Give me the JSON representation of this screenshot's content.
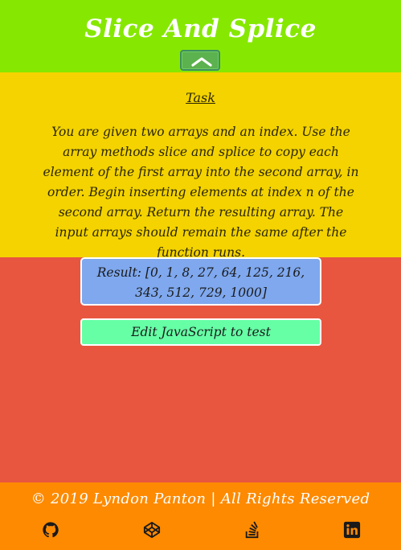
{
  "header": {
    "title": "Slice And Splice",
    "collapse_icon": "chevron-up-icon",
    "background": "#86e800"
  },
  "task": {
    "heading": "Task",
    "description": "You are given two arrays and an index. Use the array methods slice and splice to copy each element of the first array into the second array, in order. Begin inserting elements at index n of the second array. Return the resulting array. The input arrays should remain the same after the function runs.",
    "background": "#f4d300"
  },
  "result": {
    "label": "Result:",
    "value": "[0, 1, 8, 27, 64, 125, 216, 343, 512, 729, 1000]",
    "background": "#7fa8ee"
  },
  "edit_button": {
    "label": "Edit JavaScript to test",
    "background": "#66ffa6"
  },
  "footer": {
    "copyright": "© 2019 Lyndon Panton | All Rights Reserved",
    "background": "#fd8a00",
    "links": [
      {
        "icon": "github-icon"
      },
      {
        "icon": "codepen-icon"
      },
      {
        "icon": "stackoverflow-icon"
      },
      {
        "icon": "linkedin-icon"
      }
    ]
  },
  "body_background": "#e8563f"
}
